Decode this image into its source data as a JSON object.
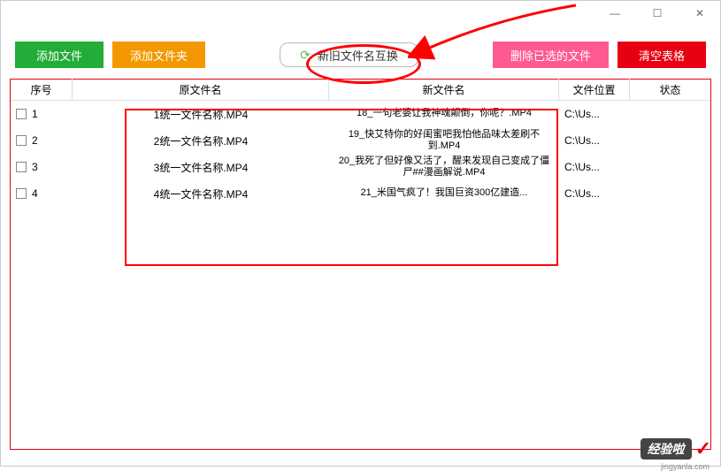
{
  "titlebar": {
    "min": "—",
    "max": "☐",
    "close": "✕"
  },
  "toolbar": {
    "add_file": "添加文件",
    "add_folder": "添加文件夹",
    "swap": "新旧文件名互换",
    "delete_sel": "删除已选的文件",
    "clear": "清空表格"
  },
  "headers": {
    "seq": "序号",
    "old": "原文件名",
    "new": "新文件名",
    "path": "文件位置",
    "status": "状态"
  },
  "rows": [
    {
      "seq": "1",
      "old": "1统一文件名称.MP4",
      "new": "18_一句老婆让我神魂颠倒，你呢？.MP4",
      "path": "C:\\Us..."
    },
    {
      "seq": "2",
      "old": "2统一文件名称.MP4",
      "new": "19_快艾特你的好闺蜜吧我怕他品味太差刷不到.MP4",
      "path": "C:\\Us..."
    },
    {
      "seq": "3",
      "old": "3统一文件名称.MP4",
      "new": "20_我死了但好像又活了，醒来发现自己变成了僵尸##漫画解说.MP4",
      "path": "C:\\Us..."
    },
    {
      "seq": "4",
      "old": "4统一文件名称.MP4",
      "new": "21_米国气疯了！我国巨资300亿建造...",
      "path": "C:\\Us..."
    }
  ],
  "watermark": {
    "text": "经验啦",
    "url": "jingyanla.com"
  }
}
